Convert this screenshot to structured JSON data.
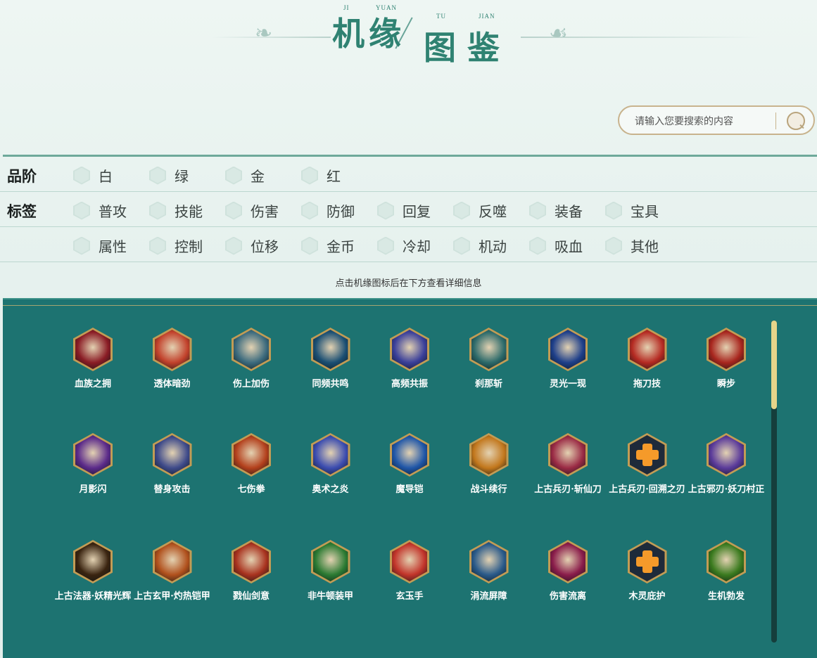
{
  "header": {
    "title_chars": [
      "机",
      "缘",
      "图",
      "鉴"
    ],
    "pinyin": [
      "JI",
      "YUAN",
      "TU",
      "JIAN"
    ]
  },
  "search": {
    "placeholder": "请输入您要搜索的内容"
  },
  "filters": {
    "grade": {
      "label": "品阶",
      "options": [
        "白",
        "绿",
        "金",
        "红"
      ]
    },
    "tags": {
      "label": "标签",
      "row1": [
        "普攻",
        "技能",
        "伤害",
        "防御",
        "回复",
        "反噬",
        "装备",
        "宝具"
      ],
      "row2": [
        "属性",
        "控制",
        "位移",
        "金币",
        "冷却",
        "机动",
        "吸血",
        "其他"
      ]
    }
  },
  "hint": "点击机缘图标后在下方查看详细信息",
  "items": [
    {
      "name": "血族之拥",
      "color": "#8a1c25"
    },
    {
      "name": "透体暗劲",
      "color": "#c2412b"
    },
    {
      "name": "伤上加伤",
      "color": "#3c6b7e"
    },
    {
      "name": "同频共鸣",
      "color": "#1b4f73"
    },
    {
      "name": "高频共振",
      "color": "#3a3f9a"
    },
    {
      "name": "刹那斩",
      "color": "#2c6a6a"
    },
    {
      "name": "灵光一现",
      "color": "#1e3f8a"
    },
    {
      "name": "拖刀技",
      "color": "#b52a22"
    },
    {
      "name": "瞬步",
      "color": "#a8261e"
    },
    {
      "name": "月影闪",
      "color": "#5b2a8a"
    },
    {
      "name": "替身攻击",
      "color": "#3e4a8a"
    },
    {
      "name": "七伤拳",
      "color": "#b3401c"
    },
    {
      "name": "奥术之炎",
      "color": "#3b4cb0"
    },
    {
      "name": "魔导铠",
      "color": "#1f56a8"
    },
    {
      "name": "战斗续行",
      "color": "#c2771c"
    },
    {
      "name": "上古兵刃·斩仙刀",
      "color": "#9a2a44"
    },
    {
      "name": "上古兵刃·回溯之刃",
      "color": "#1e2a3a",
      "plus": true
    },
    {
      "name": "上古邪刃·妖刀村正",
      "color": "#5a3a9a"
    },
    {
      "name": "上古法器·妖精光辉",
      "color": "#3a2410"
    },
    {
      "name": "上古玄甲·灼热铠甲",
      "color": "#b0501c"
    },
    {
      "name": "戮仙剑意",
      "color": "#a8321e"
    },
    {
      "name": "非牛顿装甲",
      "color": "#2b7a32"
    },
    {
      "name": "玄玉手",
      "color": "#c2342a"
    },
    {
      "name": "涓流屏障",
      "color": "#2a5a8a"
    },
    {
      "name": "伤害流离",
      "color": "#8a1c4a"
    },
    {
      "name": "木灵庇护",
      "color": "#1e2a3a",
      "plus": true
    },
    {
      "name": "生机勃发",
      "color": "#3a7a1e"
    }
  ],
  "colors": {
    "accent": "#2f8272",
    "panel": "#1d7371",
    "gold": "#c29c55",
    "scroll_thumb": "#e6d58a"
  }
}
